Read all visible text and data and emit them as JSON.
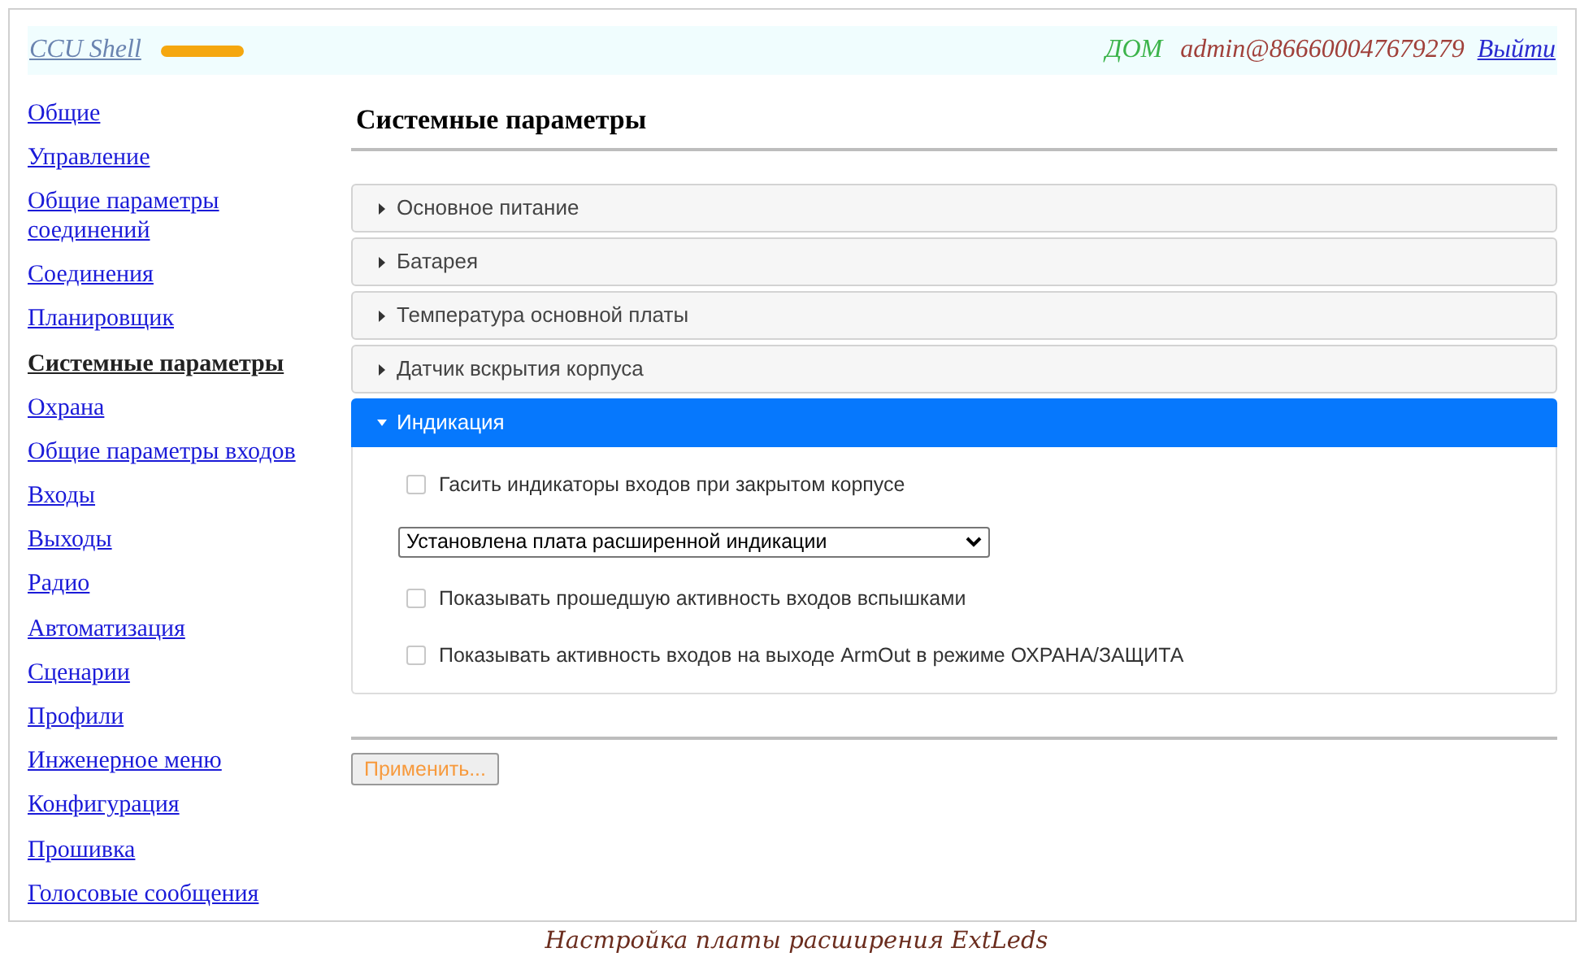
{
  "header": {
    "title": "CCU Shell",
    "location": "ДОМ",
    "user": "admin@866600047679279",
    "logout": "Выйти"
  },
  "sidebar": {
    "items": [
      {
        "label": "Общие",
        "selected": false
      },
      {
        "label": "Управление",
        "selected": false
      },
      {
        "label": "Общие параметры соединений",
        "selected": false
      },
      {
        "label": "Соединения",
        "selected": false
      },
      {
        "label": "Планировщик",
        "selected": false
      },
      {
        "label": "Системные параметры",
        "selected": true
      },
      {
        "label": "Охрана",
        "selected": false
      },
      {
        "label": "Общие параметры входов",
        "selected": false
      },
      {
        "label": "Входы",
        "selected": false
      },
      {
        "label": "Выходы",
        "selected": false
      },
      {
        "label": "Радио",
        "selected": false
      },
      {
        "label": "Автоматизация",
        "selected": false
      },
      {
        "label": "Сценарии",
        "selected": false
      },
      {
        "label": "Профили",
        "selected": false
      },
      {
        "label": "Инженерное меню",
        "selected": false
      },
      {
        "label": "Конфигурация",
        "selected": false
      },
      {
        "label": "Прошивка",
        "selected": false
      },
      {
        "label": "Голосовые сообщения",
        "selected": false
      }
    ]
  },
  "page_title": "Системные параметры",
  "sections": [
    {
      "title": "Основное питание",
      "expanded": false
    },
    {
      "title": "Батарея",
      "expanded": false
    },
    {
      "title": "Температура основной платы",
      "expanded": false
    },
    {
      "title": "Датчик вскрытия корпуса",
      "expanded": false
    },
    {
      "title": "Индикация",
      "expanded": true,
      "items": [
        {
          "kind": "checkbox",
          "label": "Гасить индикаторы входов при закрытом корпусе",
          "checked": false
        },
        {
          "kind": "select",
          "value": "Установлена плата расширенной индикации"
        },
        {
          "kind": "checkbox",
          "label": "Показывать прошедшую активность входов вспышками",
          "checked": false
        },
        {
          "kind": "checkbox",
          "label": "Показывать активность входов на выходе ArmOut в режиме ОХРАНА/ЗАЩИТА",
          "checked": false
        }
      ]
    }
  ],
  "apply_button": "Применить...",
  "caption": "Настройка платы расширения ExtLeds"
}
